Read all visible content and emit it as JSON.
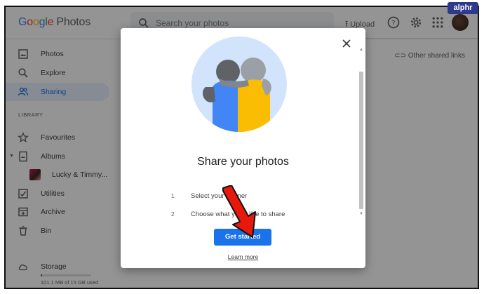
{
  "app": {
    "logo_google": [
      "G",
      "o",
      "o",
      "g",
      "l",
      "e"
    ],
    "logo_product": "Photos",
    "search_placeholder": "Search your photos",
    "upload_label": "Upload",
    "help_icon": "help-icon",
    "settings_icon": "gear-icon",
    "apps_icon": "apps-grid-icon"
  },
  "sidebar": {
    "items": [
      {
        "label": "Photos",
        "icon": "photo-icon",
        "active": false
      },
      {
        "label": "Explore",
        "icon": "search-icon",
        "active": false
      },
      {
        "label": "Sharing",
        "icon": "people-icon",
        "active": true
      }
    ],
    "library_label": "LIBRARY",
    "library_items": [
      {
        "label": "Favourites",
        "icon": "star-icon"
      },
      {
        "label": "Albums",
        "icon": "album-icon"
      },
      {
        "label": "Lucky & Timmy...",
        "icon": "album-thumbnail"
      },
      {
        "label": "Utilities",
        "icon": "utilities-icon"
      },
      {
        "label": "Archive",
        "icon": "archive-icon"
      },
      {
        "label": "Bin",
        "icon": "trash-icon"
      }
    ],
    "storage": {
      "label": "Storage",
      "usage_text": "101.1 MB of 15 GB used",
      "used_fraction": 0.007
    }
  },
  "main": {
    "other_links_label": "Other shared links"
  },
  "modal": {
    "title": "Share your photos",
    "steps": [
      {
        "num": "1",
        "text": "Select your partner"
      },
      {
        "num": "2",
        "text": "Choose what you'd like to share"
      }
    ],
    "primary_button": "Get started",
    "secondary_link": "Learn more"
  },
  "colors": {
    "accent": "#1a73e8",
    "active_bg": "#e8f0fe",
    "arrow_red": "#e8180c"
  },
  "watermark": "alphr"
}
